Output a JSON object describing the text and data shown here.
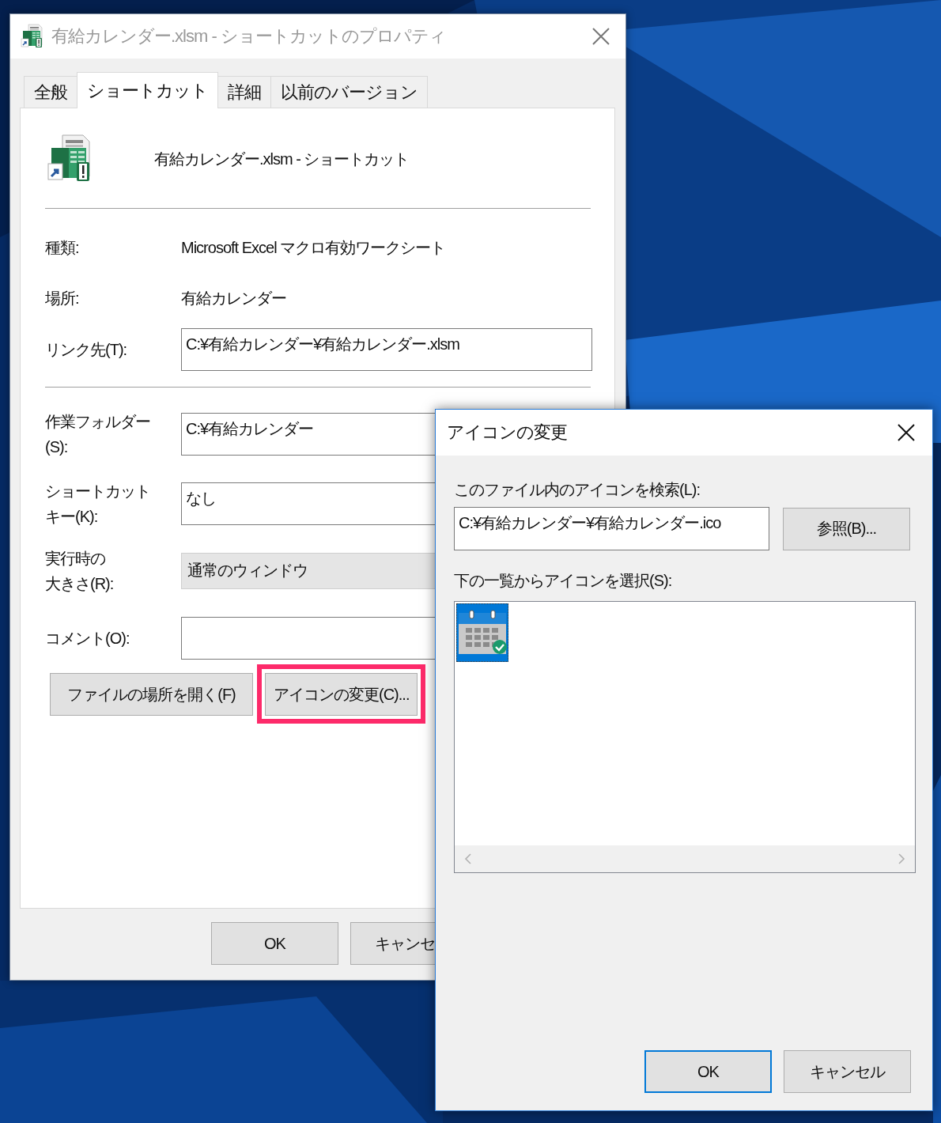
{
  "properties_window": {
    "title": "有給カレンダー.xlsm - ショートカットのプロパティ",
    "tabs": [
      {
        "label": "全般",
        "selected": false
      },
      {
        "label": "ショートカット",
        "selected": true
      },
      {
        "label": "詳細",
        "selected": false
      },
      {
        "label": "以前のバージョン",
        "selected": false
      }
    ],
    "header_name": "有給カレンダー.xlsm - ショートカット",
    "info_rows": [
      {
        "label": "種類:",
        "value": "Microsoft Excel マクロ有効ワークシート",
        "kind": "text"
      },
      {
        "label": "場所:",
        "value": "有給カレンダー",
        "kind": "text"
      },
      {
        "label": "リンク先(T):",
        "value": "C:¥有給カレンダー¥有給カレンダー.xlsm",
        "kind": "input"
      }
    ],
    "settings_rows": [
      {
        "label": "作業フォルダー(S):",
        "value": "C:¥有給カレンダー",
        "kind": "input"
      },
      {
        "label": "ショートカットキー(K):",
        "value": "なし",
        "kind": "input"
      },
      {
        "label": "実行時の大きさ(R):",
        "value": "通常のウィンドウ",
        "kind": "dropdown"
      },
      {
        "label": "コメント(O):",
        "kind": "input"
      }
    ],
    "buttons": [
      {
        "label": "ファイルの場所を開く(F)",
        "highlighted": false
      },
      {
        "label": "アイコンの変更(C)...",
        "highlighted": true
      }
    ],
    "footer_buttons": [
      "OK",
      "キャンセ"
    ]
  },
  "icon_dialog": {
    "title": "アイコンの変更",
    "search_label": "このファイル内のアイコンを検索(L):",
    "path": "C:¥有給カレンダー¥有給カレンダー.ico",
    "browse_button": "参照(B)...",
    "list_label": "下の一覧からアイコンを選択(S):",
    "icons": [
      {
        "selected": true
      }
    ],
    "buttons": [
      {
        "label": "OK",
        "default": true
      },
      {
        "label": "キャンセル",
        "default": false
      }
    ]
  }
}
